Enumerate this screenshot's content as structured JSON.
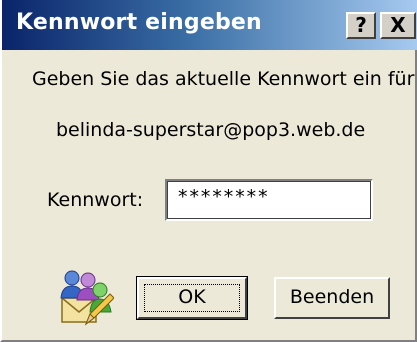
{
  "window": {
    "title": "Kennwort eingeben",
    "help_button": "?",
    "close_button": "X"
  },
  "dialog": {
    "prompt": "Geben Sie das aktuelle Kennwort ein für",
    "account": "belinda-superstar@pop3.web.de",
    "password_label": "Kennwort:",
    "password_value": "********",
    "ok_label": "OK",
    "cancel_label": "Beenden",
    "icon": "mail-users-icon"
  },
  "colors": {
    "titlebar_start": "#0a246a",
    "titlebar_end": "#a6caf0",
    "window_bg": "#ece9d8"
  }
}
